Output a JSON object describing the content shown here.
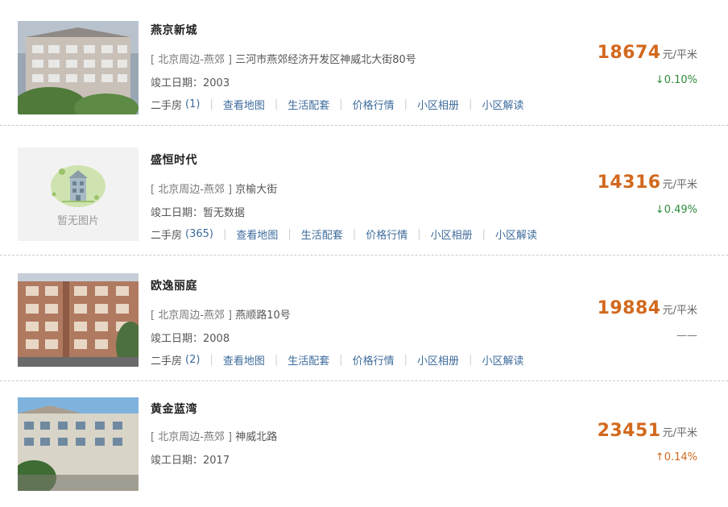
{
  "listings": [
    {
      "name": "燕京新城",
      "area": "[ 北京周边-燕郊 ]",
      "address": "三河市燕郊经济开发区神威北大街80号",
      "year_label": "竣工日期：2003",
      "price": "18674",
      "unit": "元/平米",
      "change": "↓0.10%",
      "change_dir": "down",
      "has_image": true,
      "image_alt": "",
      "secondhand_label": "二手房",
      "secondhand_count": "(1)",
      "links": [
        "查看地图",
        "生活配套",
        "价格行情",
        "小区相册",
        "小区解读"
      ]
    },
    {
      "name": "盛恒时代",
      "area": "[ 北京周边-燕郊 ]",
      "address": "京榆大街",
      "year_label": "竣工日期：暂无数据",
      "price": "14316",
      "unit": "元/平米",
      "change": "↓0.49%",
      "change_dir": "down",
      "has_image": false,
      "image_alt": "暂无图片",
      "secondhand_label": "二手房",
      "secondhand_count": "(365)",
      "links": [
        "查看地图",
        "生活配套",
        "价格行情",
        "小区相册",
        "小区解读"
      ]
    },
    {
      "name": "欧逸丽庭",
      "area": "[ 北京周边-燕郊 ]",
      "address": "燕顺路10号",
      "year_label": "竣工日期：2008",
      "price": "19884",
      "unit": "元/平米",
      "change": "——",
      "change_dir": "none",
      "has_image": true,
      "image_alt": "",
      "secondhand_label": "二手房",
      "secondhand_count": "(2)",
      "links": [
        "查看地图",
        "生活配套",
        "价格行情",
        "小区相册",
        "小区解读"
      ]
    },
    {
      "name": "黄金蓝湾",
      "area": "[ 北京周边-燕郊 ]",
      "address": "神威北路",
      "year_label": "竣工日期：2017",
      "price": "23451",
      "unit": "元/平米",
      "change": "↑0.14%",
      "change_dir": "up",
      "has_image": true,
      "image_alt": "",
      "secondhand_label": "",
      "secondhand_count": "",
      "links": []
    }
  ],
  "colors": {
    "price": "#d2691e",
    "link": "#3d6b9c",
    "down": "#2e8b3a",
    "up": "#d2691e"
  }
}
